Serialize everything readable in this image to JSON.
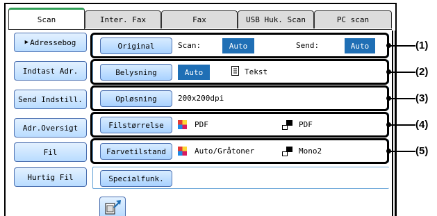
{
  "tabs": [
    "Scan",
    "Inter. Fax",
    "Fax",
    "USB Huk. Scan",
    "PC scan"
  ],
  "side": [
    "Adressebog",
    "Indtast Adr.",
    "Send Indstill.",
    "Adr.Oversigt",
    "Fil",
    "Hurtig Fil"
  ],
  "rows": {
    "original": {
      "button": "Original",
      "scan_label": "Scan:",
      "scan_value": "Auto",
      "send_label": "Send:",
      "send_value": "Auto"
    },
    "exposure": {
      "button": "Belysning",
      "value": "Auto",
      "mode": "Tekst"
    },
    "resolution": {
      "button": "Opløsning",
      "value": "200x200dpi"
    },
    "filesize": {
      "button": "Filstørrelse",
      "color_format": "PDF",
      "mono_format": "PDF"
    },
    "colormode": {
      "button": "Farvetilstand",
      "color_mode": "Auto/Gråtoner",
      "mono_mode": "Mono2"
    },
    "special": {
      "button": "Specialfunk."
    }
  },
  "callouts": [
    "(1)",
    "(2)",
    "(3)",
    "(4)",
    "(5)"
  ],
  "colors": {
    "accent_tab": "#2f9e55",
    "value_bg": "#1f6fb5",
    "button_border": "#4a6fb0"
  }
}
